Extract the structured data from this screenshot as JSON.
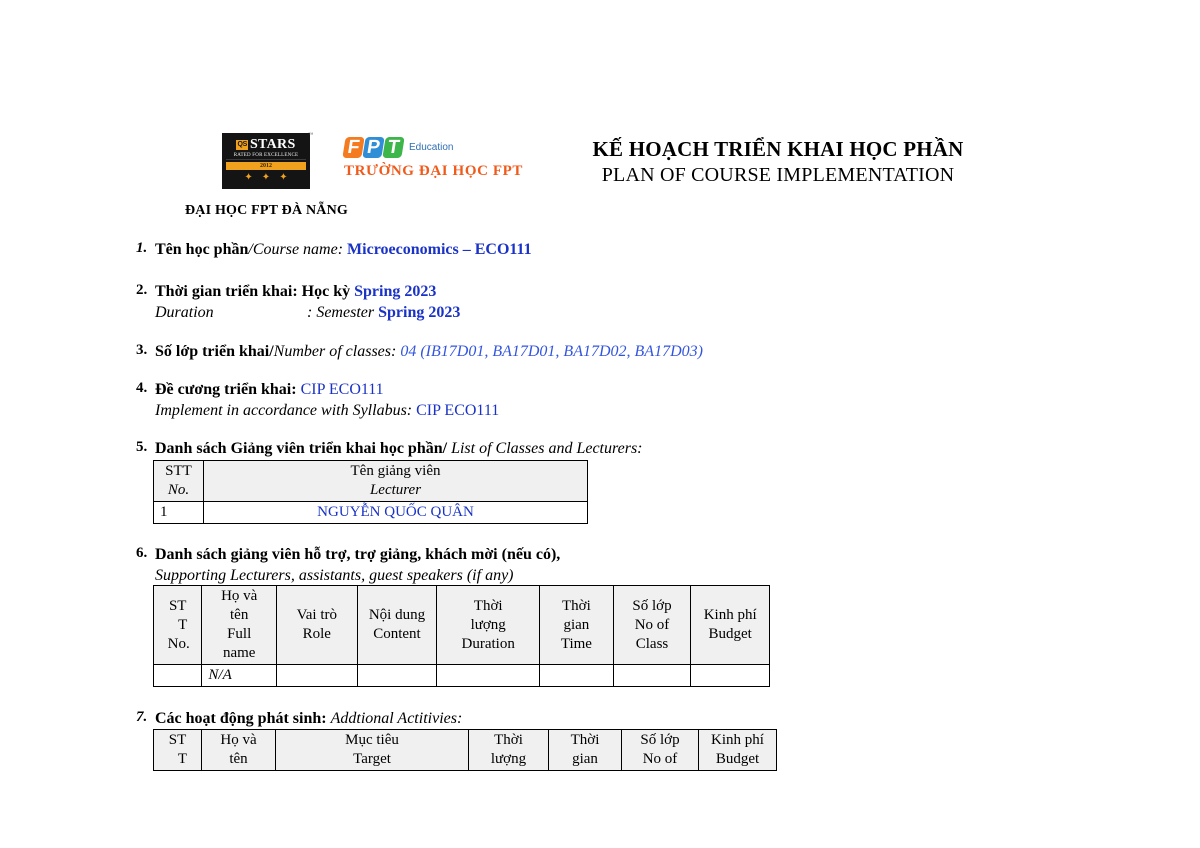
{
  "document": {
    "org": {
      "campus_name": "ĐẠI HỌC FPT ĐÀ NẴNG",
      "university_name": "TRƯỜNG ĐẠI HỌC FPT",
      "fpt_education_label": "Education",
      "fpt_letters": [
        "F",
        "P",
        "T"
      ],
      "qs_badge": {
        "mark": "QS",
        "word": "STARS",
        "tagline": "RATED FOR EXCELLENCE",
        "year": "2012",
        "star_count": 3,
        "star_glyph": "✦"
      }
    },
    "title": {
      "vietnamese": "KẾ HOẠCH TRIỂN KHAI HỌC PHẦN",
      "english": "PLAN OF COURSE IMPLEMENTATION"
    },
    "colors": {
      "value_blue": "#1a33c6",
      "fpt_orange": "#f05a1a",
      "qs_gold": "#f0a11e",
      "header_fill": "#f0f0f0"
    },
    "items": {
      "item1": {
        "number": "1.",
        "label_vn": "Tên học phần",
        "separator": "/",
        "label_en": "Course name:",
        "value": "Microeconomics – ECO111"
      },
      "item2": {
        "number": "2.",
        "label_vn": "Thời gian triển khai: Học kỳ",
        "value_vn": "Spring 2023",
        "label_en": "Duration",
        "label_en_sep": ": Semester",
        "value_en": "Spring 2023"
      },
      "item3": {
        "number": "3.",
        "label_vn": "Số lớp triển khai",
        "separator": "/",
        "label_en": "Number of classes:",
        "value": "04 (IB17D01, BA17D01, BA17D02, BA17D03)"
      },
      "item4": {
        "number": "4.",
        "label_vn": "Đề cương triển khai:",
        "value_vn": "CIP ECO111",
        "label_en": "Implement in accordance with Syllabus:",
        "value_en": "CIP ECO111"
      },
      "item5": {
        "number": "5.",
        "label_vn": "Danh sách Giảng viên triển khai học phần/",
        "label_en": "List of Classes and Lecturers:",
        "table": {
          "headers": [
            {
              "vn": "STT",
              "en": "No."
            },
            {
              "vn": "Tên giảng viên",
              "en": "Lecturer"
            }
          ],
          "rows": [
            {
              "no": "1",
              "lecturer": "NGUYỄN QUỐC QUÂN"
            }
          ]
        }
      },
      "item6": {
        "number": "6.",
        "label_vn": "Danh sách giảng viên hỗ trợ, trợ giảng, khách mời (nếu có),",
        "label_en": "Supporting Lecturers, assistants, guest speakers (if any)",
        "table": {
          "headers": [
            {
              "l1": "ST",
              "l2": "T",
              "l3": "No.",
              "l4": ""
            },
            {
              "l1": "Họ và",
              "l2": "tên",
              "l3": "Full",
              "l4": "name"
            },
            {
              "l1": "Vai trò",
              "l2": "Role",
              "l3": "",
              "l4": ""
            },
            {
              "l1": "Nội dung",
              "l2": "Content",
              "l3": "",
              "l4": ""
            },
            {
              "l1": "Thời",
              "l2": "lượng",
              "l3": "Duration",
              "l4": ""
            },
            {
              "l1": "Thời",
              "l2": "gian",
              "l3": "Time",
              "l4": ""
            },
            {
              "l1": "Số lớp",
              "l2": "No of",
              "l3": "Class",
              "l4": ""
            },
            {
              "l1": "Kinh phí",
              "l2": "Budget",
              "l3": "",
              "l4": ""
            }
          ],
          "rows": [
            {
              "stt": "",
              "full_name": "N/A",
              "role": "",
              "content": "",
              "duration": "",
              "time": "",
              "classes": "",
              "budget": ""
            }
          ]
        }
      },
      "item7": {
        "number": "7.",
        "label_vn": "Các hoạt động phát sinh:",
        "label_en": "Addtional Actitivies:",
        "table": {
          "headers": [
            {
              "l1": "ST",
              "l2": "T"
            },
            {
              "l1": "Họ và",
              "l2": "tên"
            },
            {
              "l1": "Mục tiêu",
              "l2": "Target"
            },
            {
              "l1": "Thời",
              "l2": "lượng"
            },
            {
              "l1": "Thời",
              "l2": "gian"
            },
            {
              "l1": "Số lớp",
              "l2": "No of"
            },
            {
              "l1": "Kinh phí",
              "l2": "Budget"
            }
          ]
        }
      }
    }
  }
}
